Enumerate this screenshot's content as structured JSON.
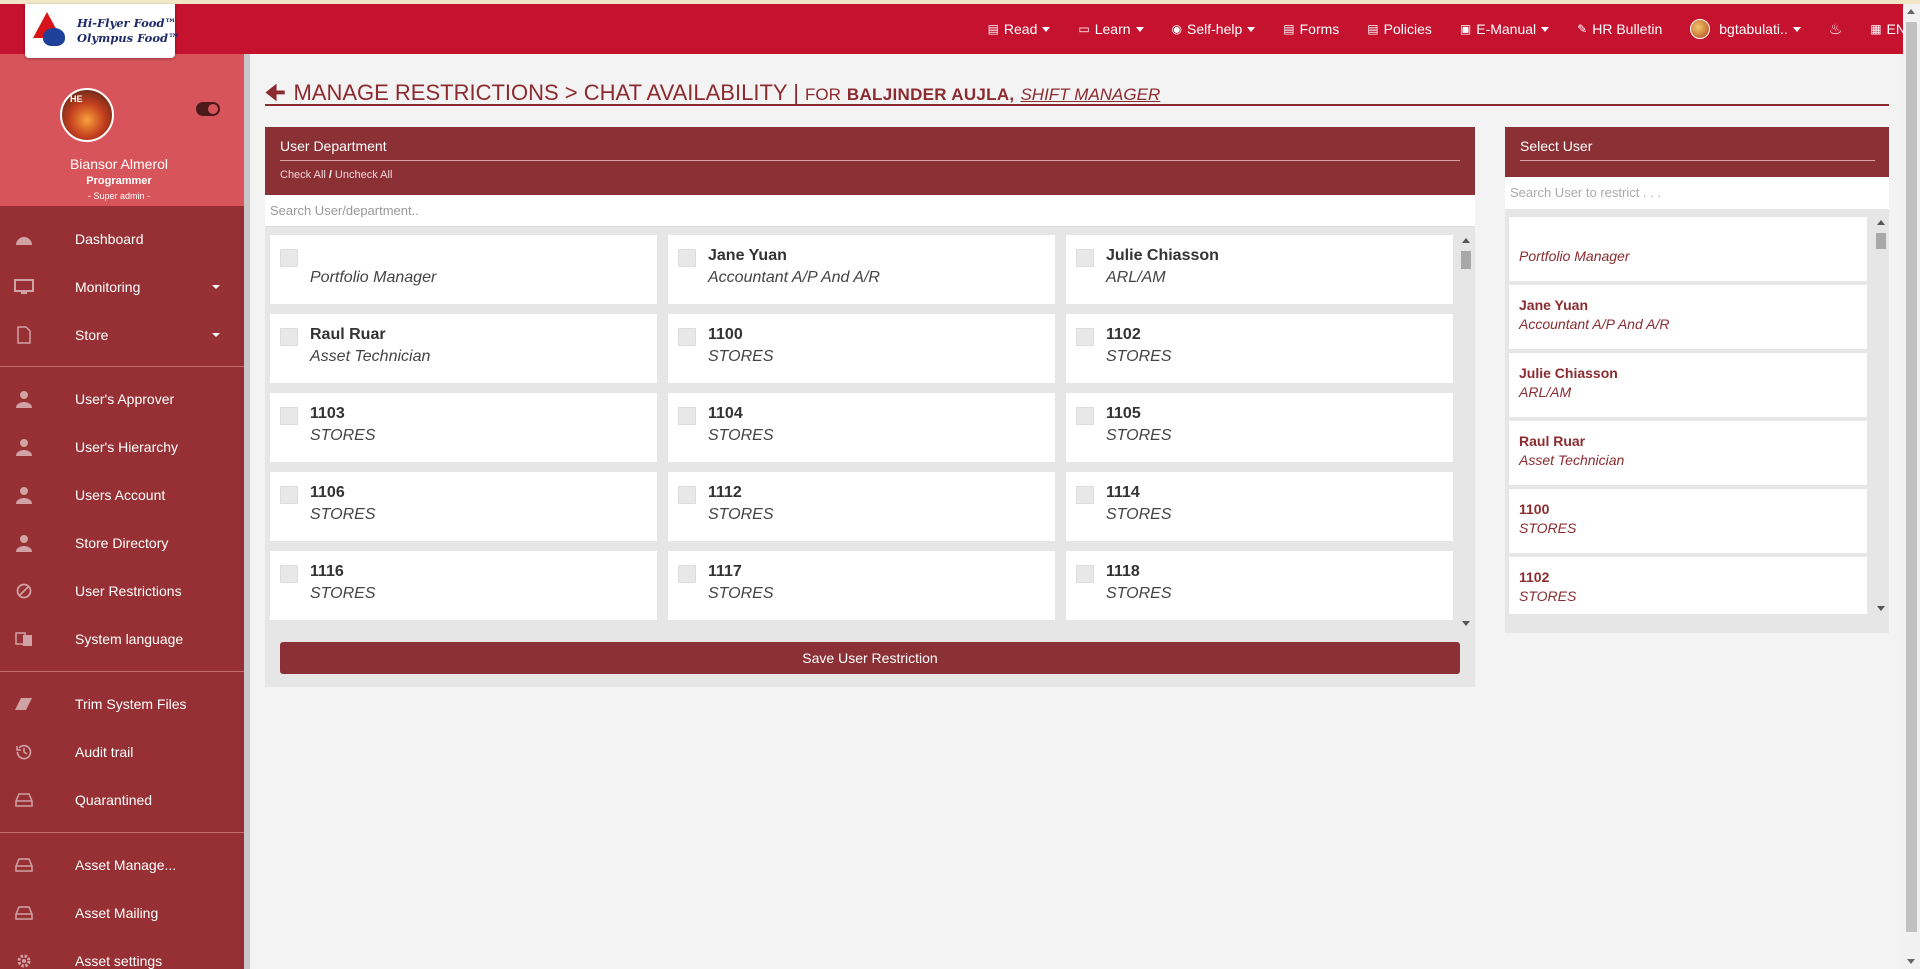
{
  "brand": {
    "line1": "Hi-Flyer Food™",
    "line2": "Olympus Food™"
  },
  "topnav": {
    "items": [
      {
        "label": "Read",
        "icon": "newspaper-icon",
        "dropdown": true
      },
      {
        "label": "Learn",
        "icon": "book-icon",
        "dropdown": true
      },
      {
        "label": "Self-help",
        "icon": "lifebuoy-icon",
        "dropdown": true
      },
      {
        "label": "Forms",
        "icon": "form-icon",
        "dropdown": false
      },
      {
        "label": "Policies",
        "icon": "list-icon",
        "dropdown": false
      },
      {
        "label": "E-Manual",
        "icon": "manual-icon",
        "dropdown": true
      },
      {
        "label": "HR Bulletin",
        "icon": "pin-icon",
        "dropdown": false
      }
    ],
    "user": "bgtabulati..",
    "language": "EN"
  },
  "profile": {
    "name": "Biansor Almerol",
    "role": "Programmer",
    "level": "- Super admin -"
  },
  "sidebar": {
    "items": [
      {
        "label": "Dashboard",
        "icon": "dashboard-icon"
      },
      {
        "label": "Monitoring",
        "icon": "monitor-icon"
      },
      {
        "label": "Store",
        "icon": "file-icon"
      },
      {
        "label": "User's Approver",
        "icon": "user-icon"
      },
      {
        "label": "User's Hierarchy",
        "icon": "user-icon"
      },
      {
        "label": "Users Account",
        "icon": "user-icon"
      },
      {
        "label": "Store Directory",
        "icon": "user-icon"
      },
      {
        "label": "User Restrictions",
        "icon": "ban-icon"
      },
      {
        "label": "System language",
        "icon": "language-icon"
      },
      {
        "label": "Trim System Files",
        "icon": "eraser-icon"
      },
      {
        "label": "Audit trail",
        "icon": "history-icon"
      },
      {
        "label": "Quarantined",
        "icon": "drive-icon"
      },
      {
        "label": "Asset Manage...",
        "icon": "drive-icon"
      },
      {
        "label": "Asset Mailing",
        "icon": "drive-icon"
      },
      {
        "label": "Asset settings",
        "icon": "gear-icon"
      }
    ]
  },
  "page": {
    "title": "MANAGE RESTRICTIONS > CHAT AVAILABILITY |",
    "for_label": "FOR",
    "for_name": "BALJINDER AUJLA,",
    "for_position": "SHIFT MANAGER"
  },
  "department_panel": {
    "title": "User Department",
    "check_all": "Check All",
    "separator": "/",
    "uncheck_all": "Uncheck All",
    "search_placeholder": "Search User/department..",
    "cards": [
      {
        "name": "",
        "role": "Portfolio Manager"
      },
      {
        "name": "Jane Yuan",
        "role": "Accountant A/P And A/R"
      },
      {
        "name": "Julie Chiasson",
        "role": "ARL/AM"
      },
      {
        "name": "Raul Ruar",
        "role": "Asset Technician"
      },
      {
        "name": "1100",
        "role": "STORES"
      },
      {
        "name": "1102",
        "role": "STORES"
      },
      {
        "name": "1103",
        "role": "STORES"
      },
      {
        "name": "1104",
        "role": "STORES"
      },
      {
        "name": "1105",
        "role": "STORES"
      },
      {
        "name": "1106",
        "role": "STORES"
      },
      {
        "name": "1112",
        "role": "STORES"
      },
      {
        "name": "1114",
        "role": "STORES"
      },
      {
        "name": "1116",
        "role": "STORES"
      },
      {
        "name": "1117",
        "role": "STORES"
      },
      {
        "name": "1118",
        "role": "STORES"
      }
    ],
    "save_label": "Save User Restriction"
  },
  "user_panel": {
    "title": "Select User",
    "search_placeholder": "Search User to restrict . . .",
    "users": [
      {
        "name": "",
        "role": "Portfolio Manager"
      },
      {
        "name": "Jane Yuan",
        "role": "Accountant A/P And A/R"
      },
      {
        "name": "Julie Chiasson",
        "role": "ARL/AM"
      },
      {
        "name": "Raul Ruar",
        "role": "Asset Technician"
      },
      {
        "name": "1100",
        "role": "STORES"
      },
      {
        "name": "1102",
        "role": "STORES"
      }
    ]
  }
}
